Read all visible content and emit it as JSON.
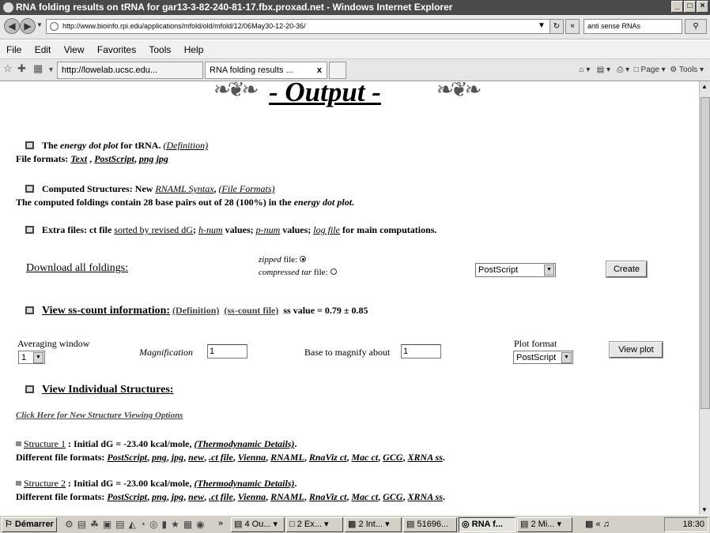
{
  "window": {
    "title": "RNA folding results on tRNA for gar13-3-82-240-81-17.fbx.proxad.net - Windows Internet Explorer"
  },
  "address": {
    "url": "http://www.bioinfo.rpi.edu/applications/mfold/old/mfold/12/06May30-12-20-36/",
    "search_value": "anti sense RNAs"
  },
  "menu": [
    "File",
    "Edit",
    "View",
    "Favorites",
    "Tools",
    "Help"
  ],
  "tabs": [
    {
      "label": "http://lowelab.ucsc.edu..."
    },
    {
      "label": "RNA folding results ...",
      "close": "x"
    }
  ],
  "command_bar": {
    "page": "Page",
    "tools": "Tools"
  },
  "content": {
    "heading": "- Output -",
    "energy_dot": {
      "pre": "The ",
      "term": "energy dot plot",
      "post": " for tRNA. ",
      "definition": "(Definition)",
      "formats_label": "File formats: ",
      "text": "Text",
      "sep": " , ",
      "postscript": "PostScript",
      "comma": ", ",
      "png": "png",
      "space": " ",
      "jpg": "jpg"
    },
    "computed": {
      "label": "Computed Structures:  New ",
      "rnaml": "RNAML Syntax",
      "comma": ",   ",
      "file_formats": "(File Formats)",
      "summary_pre": "The computed foldings contain 28 base pairs out of 28 (100%) in the ",
      "summary_term": "energy dot plot",
      "summary_post": "."
    },
    "extra": {
      "label": "Extra files:  ct file ",
      "sorted": "sorted by revised dG",
      "sep1": ";   ",
      "hnum": "h-num",
      "values1": " values;   ",
      "pnum": "p-num",
      "values2": " values;   ",
      "logfile": "log file",
      "post": " for main computations."
    },
    "download": {
      "label": "Download all foldings:",
      "zipped": "zipped",
      "file1": " file:",
      "compressed": "compressed tar",
      "file2": " file:",
      "format_selected": "PostScript",
      "create_button": "Create"
    },
    "sscount": {
      "label": "View ss-count information:",
      "definition": "(Definition)",
      "ss_file": "(ss-count file)",
      "value": "ss value = 0.79 ± 0.85"
    },
    "plot": {
      "averaging_label": "Averaging window",
      "averaging_value": "1",
      "magnification_label": "Magnification",
      "magnification_value": "1",
      "base_label": "Base to magnify about",
      "base_value": "1",
      "plot_format_label": "Plot format",
      "plot_format_selected": "PostScript",
      "view_plot_button": "View plot"
    },
    "individual": {
      "label": "View Individual Structures:"
    },
    "new_options": "Click Here for New Structure Viewing Options",
    "structures": [
      {
        "name": "Structure 1",
        "dg": " : Initial dG = -23.40 kcal/mole, ",
        "details": "(Thermodynamic Details)",
        "end": "."
      },
      {
        "name": "Structure 2",
        "dg": " : Initial dG = -23.00 kcal/mole, ",
        "details": "(Thermodynamic Details)",
        "end": "."
      }
    ],
    "different_formats": "Different file formats: ",
    "format_links": [
      "PostScript",
      "png",
      "jpg",
      "new",
      ".ct file",
      "Vienna",
      "RNAML",
      "RnaViz ct",
      "Mac ct",
      "GCG",
      "XRNA ss"
    ]
  },
  "taskbar": {
    "start": "Démarrer",
    "overflow": "»",
    "items": [
      "4 Ou...",
      "2 Ex...",
      "2 Int...",
      "51696...",
      "RNA f...",
      "2 Mi..."
    ],
    "tray": "«",
    "clock": "18:30"
  }
}
